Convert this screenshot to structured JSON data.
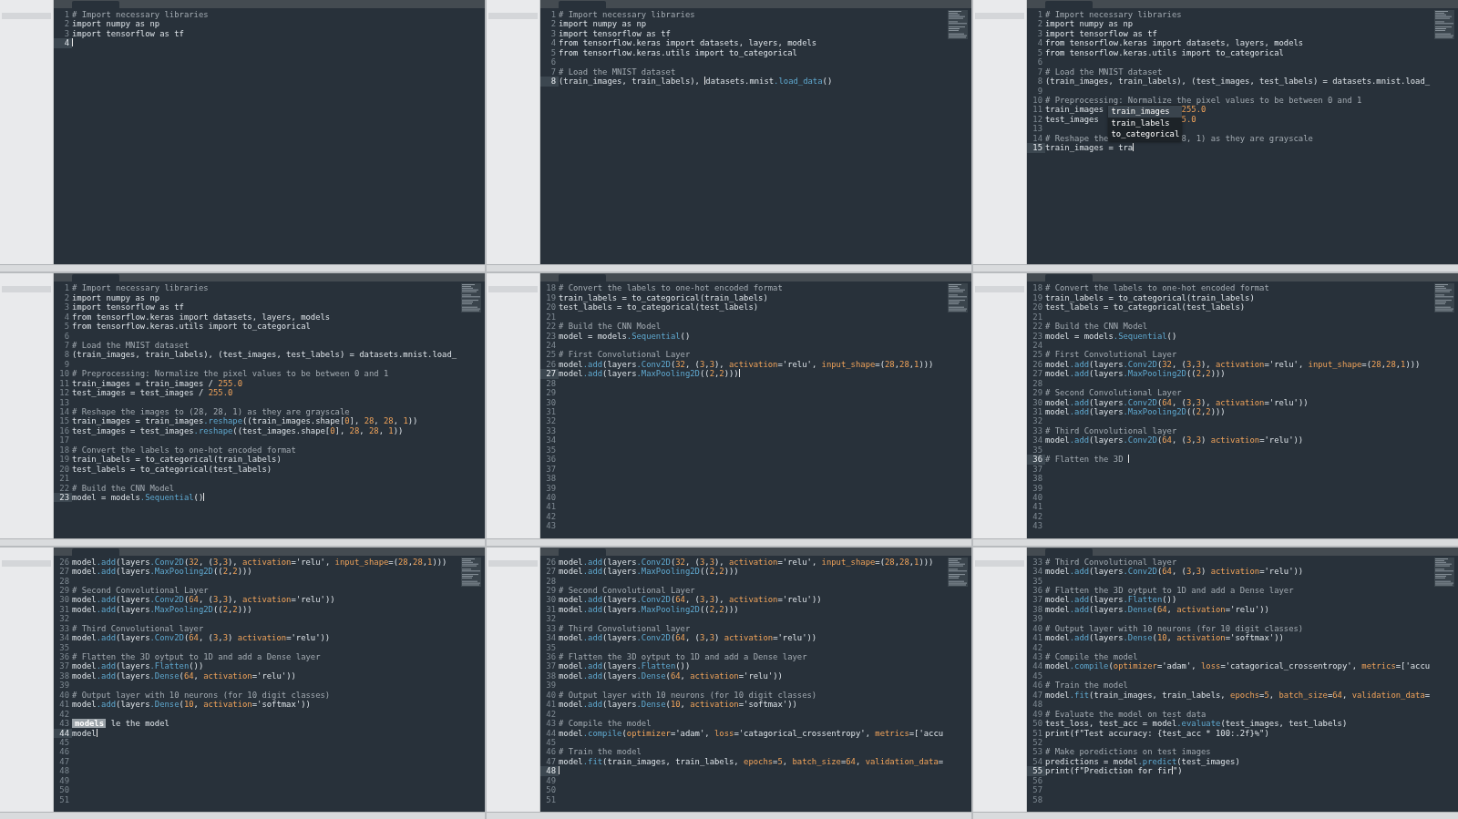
{
  "panels": [
    {
      "minimap": false,
      "lines": [
        {
          "n": "1",
          "code": "# Import necessary libraries",
          "active": false
        },
        {
          "n": "2",
          "code": "import numpy as np",
          "active": false
        },
        {
          "n": "3",
          "code": "import tensorflow as tf",
          "active": false
        },
        {
          "n": "4",
          "active": true
        }
      ]
    },
    {
      "minimap": true,
      "lines": [
        {
          "n": "1",
          "code": "# Import necessary libraries",
          "active": false
        },
        {
          "n": "2",
          "code": "import numpy as np",
          "active": false
        },
        {
          "n": "3",
          "code": "import tensorflow as tf",
          "active": false
        },
        {
          "n": "4",
          "code": "from tensorflow.keras import datasets, layers, models",
          "active": false
        },
        {
          "n": "5",
          "code": "from tensorflow.keras.utils import to_categorical",
          "active": false
        },
        {
          "n": "6",
          "active": false
        },
        {
          "n": "7",
          "code": "# Load the MNIST dataset",
          "active": false
        },
        {
          "n": "8",
          "code": "(train_images, train_labels), ",
          "code_after": "datasets.mnist.load_data()",
          "active": true
        }
      ]
    },
    {
      "minimap": true,
      "lines": [
        {
          "n": "1",
          "code": "# Import necessary libraries",
          "active": false
        },
        {
          "n": "2",
          "code": "import numpy as np",
          "active": false
        },
        {
          "n": "3",
          "code": "import tensorflow as tf",
          "active": false
        },
        {
          "n": "4",
          "code": "from tensorflow.keras import datasets, layers, models",
          "active": false
        },
        {
          "n": "5",
          "code": "from tensorflow.keras.utils import to_categorical",
          "active": false
        },
        {
          "n": "6",
          "active": false
        },
        {
          "n": "7",
          "code": "# Load the MNIST dataset",
          "active": false
        },
        {
          "n": "8",
          "code": "(train_images, train_labels), (test_images, test_labels) = datasets.mnist.load_",
          "active": false
        },
        {
          "n": "9",
          "active": false
        },
        {
          "n": "10",
          "code": "# Preprocessing: Normalize the pixel values to be between 0 and 1",
          "active": false
        },
        {
          "n": "11",
          "code": "train_images ",
          "code_after": "255.0",
          "active": false,
          "completion": [
            {
              "label": "train_images",
              "selected": true
            },
            {
              "label": "train_labels",
              "selected": false
            },
            {
              "label": "to_categorical",
              "selected": false
            }
          ]
        },
        {
          "n": "12",
          "code": "test_images",
          "code_after": "5.0",
          "covered": true,
          "active": false
        },
        {
          "n": "13",
          "active": false
        },
        {
          "n": "14",
          "code": "# Reshape the",
          "code_after": "8, 1) as they are grayscale",
          "covered": true,
          "active": false
        },
        {
          "n": "15",
          "code": "train_images = tra",
          "active": true
        }
      ]
    },
    {
      "minimap": true,
      "lines": [
        {
          "n": "1",
          "code": "# Import necessary libraries",
          "active": false
        },
        {
          "n": "2",
          "code": "import numpy as np",
          "active": false
        },
        {
          "n": "3",
          "code": "import tensorflow as tf",
          "active": false
        },
        {
          "n": "4",
          "code": "from tensorflow.keras import datasets, layers, models",
          "active": false
        },
        {
          "n": "5",
          "code": "from tensorflow.keras.utils import to_categorical",
          "active": false
        },
        {
          "n": "6",
          "active": false
        },
        {
          "n": "7",
          "code": "# Load the MNIST dataset",
          "active": false
        },
        {
          "n": "8",
          "code": "(train_images, train_labels), (test_images, test_labels) = datasets.mnist.load_",
          "active": false
        },
        {
          "n": "9",
          "active": false
        },
        {
          "n": "10",
          "code": "# Preprocessing: Normalize the pixel values to be between 0 and 1",
          "active": false
        },
        {
          "n": "11",
          "code": "train_images = train_images / 255.0",
          "active": false
        },
        {
          "n": "12",
          "code": "test_images = test_images / 255.0",
          "active": false
        },
        {
          "n": "13",
          "active": false
        },
        {
          "n": "14",
          "code": "# Reshape the images to (28, 28, 1) as they are grayscale",
          "active": false
        },
        {
          "n": "15",
          "code": "train_images = train_images.reshape((train_images.shape[0], 28, 28, 1))",
          "active": false
        },
        {
          "n": "16",
          "code": "test_images = test_images.reshape((test_images.shape[0], 28, 28, 1))",
          "active": false
        },
        {
          "n": "17",
          "active": false
        },
        {
          "n": "18",
          "code": "# Convert the labels to one-hot encoded format",
          "active": false
        },
        {
          "n": "19",
          "code": "train_labels = to_categorical(train_labels)",
          "active": false
        },
        {
          "n": "20",
          "code": "test_labels = to_categorical(test_labels)",
          "active": false
        },
        {
          "n": "21",
          "active": false
        },
        {
          "n": "22",
          "code": "# Build the CNN Model",
          "active": false
        },
        {
          "n": "23",
          "code": "model = models.Sequential()",
          "active": true
        }
      ]
    },
    {
      "minimap": true,
      "lines": [
        {
          "n": "18",
          "code": "# Convert the labels to one-hot encoded format",
          "active": false
        },
        {
          "n": "19",
          "code": "train_labels = to_categorical(train_labels)",
          "active": false
        },
        {
          "n": "20",
          "code": "test_labels = to_categorical(test_labels)",
          "active": false
        },
        {
          "n": "21",
          "active": false
        },
        {
          "n": "22",
          "code": "# Build the CNN Model",
          "active": false
        },
        {
          "n": "23",
          "code": "model = models.Sequential()",
          "active": false
        },
        {
          "n": "24",
          "active": false
        },
        {
          "n": "25",
          "code": "# First Convolutional Layer",
          "active": false
        },
        {
          "n": "26",
          "code": "model.add(layers.Conv2D(32, (3,3), activation='relu', input_shape=(28,28,1)))",
          "active": false
        },
        {
          "n": "27",
          "code": "model.add(layers.MaxPooling2D((2,2)))",
          "active": true
        },
        {
          "n": "28",
          "active": false
        },
        {
          "n": "29",
          "active": false
        },
        {
          "n": "30",
          "active": false
        },
        {
          "n": "31",
          "active": false
        },
        {
          "n": "32",
          "active": false
        },
        {
          "n": "33",
          "active": false
        },
        {
          "n": "34",
          "active": false
        },
        {
          "n": "35",
          "active": false
        },
        {
          "n": "36",
          "active": false
        },
        {
          "n": "37",
          "active": false
        },
        {
          "n": "38",
          "active": false
        },
        {
          "n": "39",
          "active": false
        },
        {
          "n": "40",
          "active": false
        },
        {
          "n": "41",
          "active": false
        },
        {
          "n": "42",
          "active": false
        },
        {
          "n": "43",
          "active": false
        }
      ]
    },
    {
      "minimap": true,
      "lines": [
        {
          "n": "18",
          "code": "# Convert the labels to one-hot encoded format",
          "active": false
        },
        {
          "n": "19",
          "code": "train_labels = to_categorical(train_labels)",
          "active": false
        },
        {
          "n": "20",
          "code": "test_labels = to_categorical(test_labels)",
          "active": false
        },
        {
          "n": "21",
          "active": false
        },
        {
          "n": "22",
          "code": "# Build the CNN Model",
          "active": false
        },
        {
          "n": "23",
          "code": "model = models.Sequential()",
          "active": false
        },
        {
          "n": "24",
          "active": false
        },
        {
          "n": "25",
          "code": "# First Convolutional Layer",
          "active": false
        },
        {
          "n": "26",
          "code": "model.add(layers.Conv2D(32, (3,3), activation='relu', input_shape=(28,28,1)))",
          "active": false
        },
        {
          "n": "27",
          "code": "model.add(layers.MaxPooling2D((2,2)))",
          "active": false
        },
        {
          "n": "28",
          "active": false
        },
        {
          "n": "29",
          "code": "# Second Convolutional Layer",
          "active": false
        },
        {
          "n": "30",
          "code": "model.add(layers.Conv2D(64, (3,3), activation='relu'))",
          "active": false
        },
        {
          "n": "31",
          "code": "model.add(layers.MaxPooling2D((2,2)))",
          "active": false
        },
        {
          "n": "32",
          "active": false
        },
        {
          "n": "33",
          "code": "# Third Convolutional layer",
          "active": false
        },
        {
          "n": "34",
          "code": "model.add(layers.Conv2D(64, (3,3) activation='relu'))",
          "active": false
        },
        {
          "n": "35",
          "active": false
        },
        {
          "n": "36",
          "code": "# Flatten the 3D ",
          "active": true
        },
        {
          "n": "37",
          "active": false
        },
        {
          "n": "38",
          "active": false
        },
        {
          "n": "39",
          "active": false
        },
        {
          "n": "40",
          "active": false
        },
        {
          "n": "41",
          "active": false
        },
        {
          "n": "42",
          "active": false
        },
        {
          "n": "43",
          "active": false
        }
      ]
    },
    {
      "minimap": true,
      "lines": [
        {
          "n": "26",
          "code": "model.add(layers.Conv2D(32, (3,3), activation='relu', input_shape=(28,28,1)))",
          "active": false
        },
        {
          "n": "27",
          "code": "model.add(layers.MaxPooling2D((2,2)))",
          "active": false
        },
        {
          "n": "28",
          "active": false
        },
        {
          "n": "29",
          "code": "# Second Convolutional Layer",
          "active": false
        },
        {
          "n": "30",
          "code": "model.add(layers.Conv2D(64, (3,3), activation='relu'))",
          "active": false
        },
        {
          "n": "31",
          "code": "model.add(layers.MaxPooling2D((2,2)))",
          "active": false
        },
        {
          "n": "32",
          "active": false
        },
        {
          "n": "33",
          "code": "# Third Convolutional layer",
          "active": false
        },
        {
          "n": "34",
          "code": "model.add(layers.Conv2D(64, (3,3) activation='relu'))",
          "active": false
        },
        {
          "n": "35",
          "active": false
        },
        {
          "n": "36",
          "code": "# Flatten the 3D oytput to 1D and add a Dense layer",
          "active": false
        },
        {
          "n": "37",
          "code": "model.add(layers.Flatten())",
          "active": false
        },
        {
          "n": "38",
          "code": "model.add(layers.Dense(64, activation='relu'))",
          "active": false
        },
        {
          "n": "39",
          "active": false
        },
        {
          "n": "40",
          "code": "# Output layer with 10 neurons (for 10 digit classes)",
          "active": false
        },
        {
          "n": "41",
          "code": "model.add(layers.Dense(10, activation='softmax'))",
          "active": false
        },
        {
          "n": "42",
          "active": false
        },
        {
          "n": "43",
          "code_after": " le the model",
          "active": false,
          "completion": [
            {
              "label": "models",
              "selected": true
            }
          ]
        },
        {
          "n": "44",
          "code": "model",
          "active": true
        },
        {
          "n": "45",
          "active": false
        },
        {
          "n": "46",
          "active": false
        },
        {
          "n": "47",
          "active": false
        },
        {
          "n": "48",
          "active": false
        },
        {
          "n": "49",
          "active": false
        },
        {
          "n": "50",
          "active": false
        },
        {
          "n": "51",
          "active": false
        }
      ]
    },
    {
      "minimap": true,
      "lines": [
        {
          "n": "26",
          "code": "model.add(layers.Conv2D(32, (3,3), activation='relu', input_shape=(28,28,1)))",
          "active": false
        },
        {
          "n": "27",
          "code": "model.add(layers.MaxPooling2D((2,2)))",
          "active": false
        },
        {
          "n": "28",
          "active": false
        },
        {
          "n": "29",
          "code": "# Second Convolutional Layer",
          "active": false
        },
        {
          "n": "30",
          "code": "model.add(layers.Conv2D(64, (3,3), activation='relu'))",
          "active": false
        },
        {
          "n": "31",
          "code": "model.add(layers.MaxPooling2D((2,2)))",
          "active": false
        },
        {
          "n": "32",
          "active": false
        },
        {
          "n": "33",
          "code": "# Third Convolutional layer",
          "active": false
        },
        {
          "n": "34",
          "code": "model.add(layers.Conv2D(64, (3,3) activation='relu'))",
          "active": false
        },
        {
          "n": "35",
          "active": false
        },
        {
          "n": "36",
          "code": "# Flatten the 3D oytput to 1D and add a Dense layer",
          "active": false
        },
        {
          "n": "37",
          "code": "model.add(layers.Flatten())",
          "active": false
        },
        {
          "n": "38",
          "code": "model.add(layers.Dense(64, activation='relu'))",
          "active": false
        },
        {
          "n": "39",
          "active": false
        },
        {
          "n": "40",
          "code": "# Output layer with 10 neurons (for 10 digit classes)",
          "active": false
        },
        {
          "n": "41",
          "code": "model.add(layers.Dense(10, activation='softmax'))",
          "active": false
        },
        {
          "n": "42",
          "active": false
        },
        {
          "n": "43",
          "code": "# Compile the model",
          "active": false
        },
        {
          "n": "44",
          "code": "model.compile(optimizer='adam', loss='catagorical_crossentropy', metrics=['accu",
          "active": false
        },
        {
          "n": "45",
          "active": false
        },
        {
          "n": "46",
          "code": "# Train the model",
          "active": false
        },
        {
          "n": "47",
          "code": "model.fit(train_images, train_labels, epochs=5, batch_size=64, validation_data=",
          "active": false
        },
        {
          "n": "48",
          "active": true
        },
        {
          "n": "49",
          "active": false
        },
        {
          "n": "50",
          "active": false
        },
        {
          "n": "51",
          "active": false
        }
      ]
    },
    {
      "minimap": true,
      "lines": [
        {
          "n": "33",
          "code": "# Third Convolutional layer",
          "active": false
        },
        {
          "n": "34",
          "code": "model.add(layers.Conv2D(64, (3,3) activation='relu'))",
          "active": false
        },
        {
          "n": "35",
          "active": false
        },
        {
          "n": "36",
          "code": "# Flatten the 3D oytput to 1D and add a Dense layer",
          "active": false
        },
        {
          "n": "37",
          "code": "model.add(layers.Flatten())",
          "active": false
        },
        {
          "n": "38",
          "code": "model.add(layers.Dense(64, activation='relu'))",
          "active": false
        },
        {
          "n": "39",
          "active": false
        },
        {
          "n": "40",
          "code": "# Output layer with 10 neurons (for 10 digit classes)",
          "active": false
        },
        {
          "n": "41",
          "code": "model.add(layers.Dense(10, activation='softmax'))",
          "active": false
        },
        {
          "n": "42",
          "active": false
        },
        {
          "n": "43",
          "code": "# Compile the model",
          "active": false
        },
        {
          "n": "44",
          "code": "model.compile(optimizer='adam', loss='catagorical_crossentropy', metrics=['accu",
          "active": false
        },
        {
          "n": "45",
          "active": false
        },
        {
          "n": "46",
          "code": "# Train the model",
          "active": false
        },
        {
          "n": "47",
          "code": "model.fit(train_images, train_labels, epochs=5, batch_size=64, validation_data=",
          "active": false
        },
        {
          "n": "48",
          "active": false
        },
        {
          "n": "49",
          "code": "# Evaluate the model on test data",
          "active": false
        },
        {
          "n": "50",
          "code": "test_loss, test_acc = model.evaluate(test_images, test_labels)",
          "active": false
        },
        {
          "n": "51",
          "code": "print(f\"Test accuracy: {test_acc * 100:.2f}%\")",
          "active": false
        },
        {
          "n": "52",
          "active": false
        },
        {
          "n": "53",
          "code": "# Make poredictions on test images",
          "active": false
        },
        {
          "n": "54",
          "code": "predictions = model.predict(test_images)",
          "active": false
        },
        {
          "n": "55",
          "code": "print(f\"Prediction for fir",
          "code_after": "\")",
          "active": true
        },
        {
          "n": "56",
          "active": false
        },
        {
          "n": "57",
          "active": false
        },
        {
          "n": "58",
          "active": false
        }
      ]
    }
  ]
}
